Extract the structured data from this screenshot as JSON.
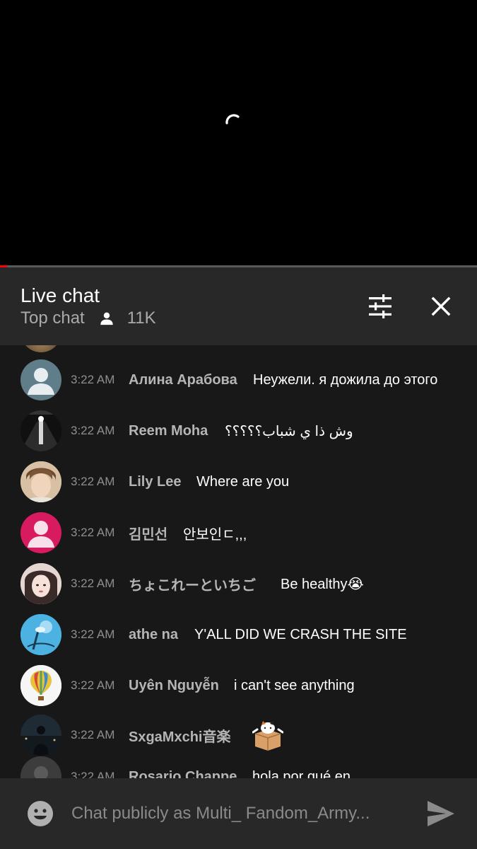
{
  "video": {
    "progress_fraction": 0.015,
    "accent_color": "#ff0000"
  },
  "header": {
    "title": "Live chat",
    "mode": "Top chat",
    "viewer_count": "11K",
    "icons": {
      "viewers": "person-icon",
      "filter": "tune-icon",
      "close": "close-icon"
    }
  },
  "messages": [
    {
      "time": "3:22 AM",
      "author": "Алина Арабова",
      "text": "Неужели. я дожила до этого",
      "avatar": "default-avatar-slate"
    },
    {
      "time": "3:22 AM",
      "author": "Reem Moha",
      "text": "وش ذا ي شباب؟؟؟؟؟",
      "avatar": "photo-avatar-dark"
    },
    {
      "time": "3:22 AM",
      "author": "Lily Lee",
      "text": "Where are you",
      "avatar": "photo-avatar-face"
    },
    {
      "time": "3:22 AM",
      "author": "김민선",
      "text": "안보인ㄷ,,,",
      "avatar": "default-avatar-pink"
    },
    {
      "time": "3:22 AM",
      "author": "ちょこれーといちご",
      "text": "Be healthy😭",
      "avatar": "photo-avatar-face"
    },
    {
      "time": "3:22 AM",
      "author": "athe na",
      "text": "Y'ALL DID WE CRASH THE SITE",
      "avatar": "photo-avatar-blue"
    },
    {
      "time": "3:22 AM",
      "author": "Uyên Nguyễn",
      "text": "i can't see anything",
      "avatar": "balloon-avatar"
    },
    {
      "time": "3:22 AM",
      "author": "SxgaMxchi音楽",
      "text": "",
      "avatar": "photo-avatar-night",
      "sticker": "cat-box-sticker"
    },
    {
      "time": "3:22 AM",
      "author": "Rosario Chappe",
      "text": "hola por qué en",
      "avatar": "photo-avatar-dark"
    }
  ],
  "input": {
    "placeholder": "Chat publicly as Multi_ Fandom_Army...",
    "icons": {
      "emoji": "emoji-icon",
      "send": "send-icon"
    }
  }
}
